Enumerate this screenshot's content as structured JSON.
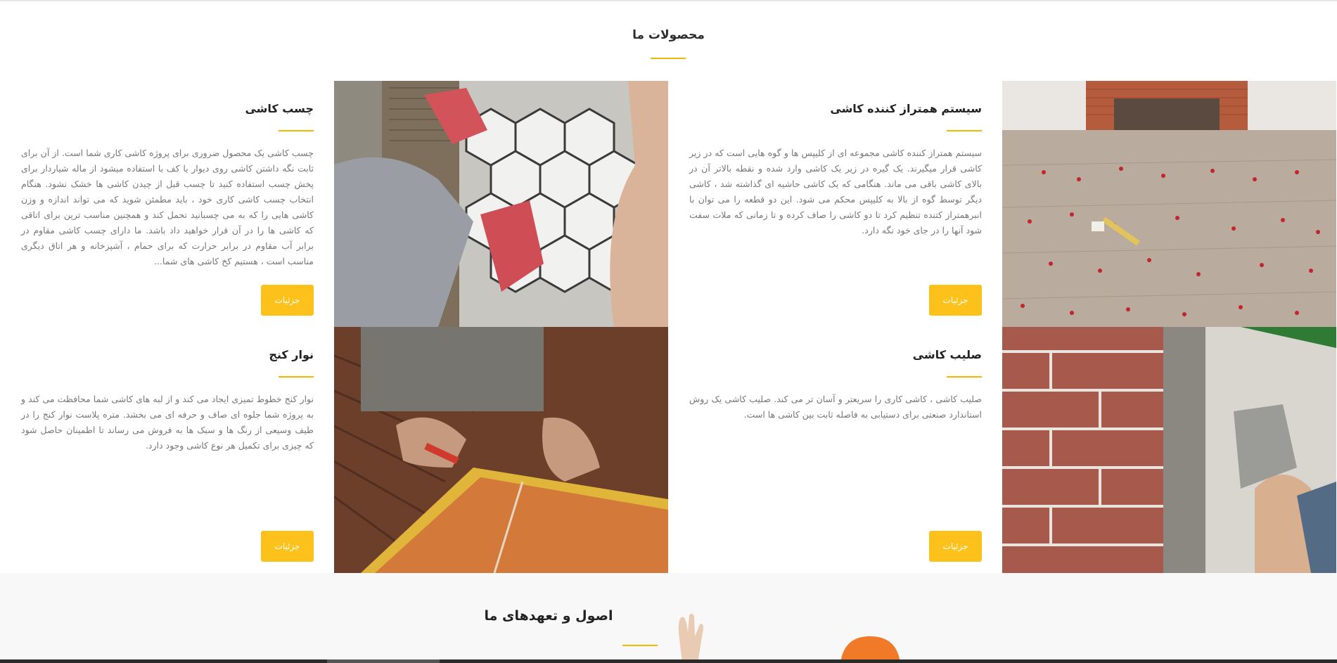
{
  "products_section": {
    "title": "محصولات ما"
  },
  "products": [
    {
      "title": "سیستم همتراز کننده کاشی",
      "description": "سیستم همتراز کننده کاشی مجموعه ای از کلیپس ها و گوه هایی است که در زیر کاشی قرار میگیرند. یک گیره در زیر یک کاشی وارد شده و نقطه بالاتر آن در بالای کاشی باقی می ماند. هنگامی که یک کاشی حاشیه ای گذاشته شد ، کاشی دیگر توسط گوه از بالا به کلیپس محکم می شود. این دو قطعه را می توان با انبرهمتراز کتنده تنظیم کرد تا دو کاشی را صاف کرده و تا زمانی که ملات سفت شود آنها را در جای خود نگه دارد.",
      "button": "جزئیات"
    },
    {
      "title": "چسب کاشی",
      "description": "چسب کاشی یک محصول ضروری برای پروژه کاشی کاری شما است. از آن برای ثابت نگه داشتن کاشی روی دیوار یا کف با استفاده میشود از ماله شیاردار برای پخش چسب استفاده کنید تا چسب قبل از چیدن کاشی ها خشک نشود. هنگام انتخاب چسب کاشی کاری خود ، باید مطمئن شوید که می تواند اندازه و وزن کاشی هایی را که به می چسبانید تحمل کند و همچنین مناسب ترین برای اتاقی که کاشی ها را در آن قرار خواهید داد باشد. ما دارای چسب کاشی مقاوم در برابر آب مقاوم در برابر حرارت که برای حمام ، آشپزخانه و هر اتاق دیگری مناسب است ، هستیم کخ کاشی های شما...",
      "button": "جزئیات"
    },
    {
      "title": "صلیب کاشی",
      "description": "صلیب کاشی ، کاشی کاری را سریعتر و آسان تر می کند. صلیب کاشی یک روش استاندارد صنعتی برای دستیابی به فاصله ثابت بین کاشی ها است.",
      "button": "جزئیات"
    },
    {
      "title": "نوار کنج",
      "description": "نوار کنج خطوط تمیزی ایجاد می کند و از لبه های کاشی شما محافظت می کند و به پروژه شما جلوه ای صاف و حرفه ای می بخشد. متره پلاست نوار کنج را در طیف وسیعی از رنگ ها و سبک ها به فروش می رساند تا اطمینان حاصل شود که چیزی برای تکمیل هر نوع کاشی وجود دارد.",
      "button": "جزئیات"
    }
  ],
  "principles_section": {
    "title": "اصول و تعهدهای ما"
  },
  "colors": {
    "accent": "#fcc21b",
    "underline": "#f5b800"
  }
}
